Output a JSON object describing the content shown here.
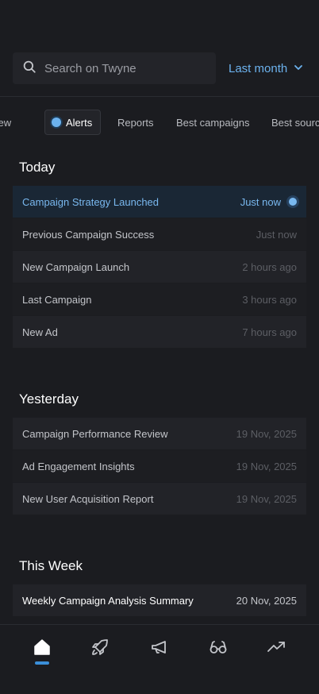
{
  "header": {
    "search_placeholder": "Search on Twyne",
    "period_label": "Last month"
  },
  "tabs": [
    {
      "label": "Overview"
    },
    {
      "label": "Alerts"
    },
    {
      "label": "Reports"
    },
    {
      "label": "Best campaigns"
    },
    {
      "label": "Best sources"
    }
  ],
  "sections": {
    "today": {
      "title": "Today",
      "items": [
        {
          "title": "Campaign Strategy Launched",
          "time": "Just now"
        },
        {
          "title": "Previous Campaign Success",
          "time": "Just now"
        },
        {
          "title": "New Campaign Launch",
          "time": "2 hours ago"
        },
        {
          "title": "Last Campaign",
          "time": "3 hours ago"
        },
        {
          "title": "New Ad",
          "time": "7 hours ago"
        }
      ]
    },
    "yesterday": {
      "title": "Yesterday",
      "items": [
        {
          "title": "Campaign Performance Review",
          "time": "19 Nov, 2025"
        },
        {
          "title": "Ad Engagement Insights",
          "time": "19 Nov, 2025"
        },
        {
          "title": "New User Acquisition Report",
          "time": "19 Nov, 2025"
        }
      ]
    },
    "this_week": {
      "title": "This Week",
      "items": [
        {
          "title": "Weekly Campaign Analysis Summary",
          "time": "20 Nov, 2025"
        }
      ]
    }
  },
  "bottom_nav": [
    {
      "icon": "home-icon"
    },
    {
      "icon": "rocket-icon"
    },
    {
      "icon": "megaphone-icon"
    },
    {
      "icon": "glasses-icon"
    },
    {
      "icon": "trending-up-icon"
    }
  ],
  "colors": {
    "accent": "#6cb2ee",
    "background": "#1b1c20"
  }
}
